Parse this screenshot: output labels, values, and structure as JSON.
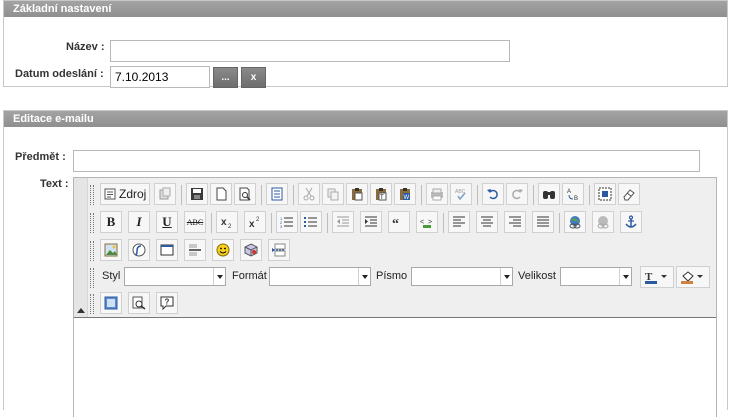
{
  "sections": {
    "basic": {
      "title": "Základní nastavení",
      "name_label": "Název :",
      "name_value": "",
      "date_label": "Datum odeslání :",
      "date_value": "7.10.2013",
      "picker_label": "...",
      "clear_label": "x"
    },
    "email": {
      "title": "Editace e-mailu",
      "subject_label": "Předmět :",
      "subject_value": "",
      "text_label": "Text :"
    }
  },
  "editor": {
    "source_label": "Zdroj",
    "style_label": "Styl",
    "format_label": "Formát",
    "font_label": "Písmo",
    "size_label": "Velikost",
    "style_value": "",
    "format_value": "",
    "font_value": "",
    "size_value": "",
    "bold_label": "B",
    "italic_label": "I",
    "underline_label": "U",
    "strike_label": "ABC",
    "icons": [
      "source-icon",
      "preview-icon",
      "save-icon",
      "new-page-icon",
      "print-preview-icon",
      "templates-icon",
      "cut-icon",
      "copy-icon",
      "paste-icon",
      "paste-text-icon",
      "paste-word-icon",
      "print-icon",
      "spellcheck-icon",
      "undo-icon",
      "redo-icon",
      "find-icon",
      "replace-icon",
      "select-all-icon",
      "remove-format-icon",
      "subscript-icon",
      "superscript-icon",
      "numbered-list-icon",
      "bulleted-list-icon",
      "outdent-icon",
      "indent-icon",
      "blockquote-icon",
      "div-icon",
      "align-left-icon",
      "align-center-icon",
      "align-right-icon",
      "justify-icon",
      "link-icon",
      "unlink-icon",
      "anchor-icon",
      "image-icon",
      "flash-icon",
      "table-icon",
      "horizontal-rule-icon",
      "smiley-icon",
      "special-char-icon",
      "page-break-icon",
      "text-color-icon",
      "background-color-icon",
      "maximize-icon",
      "show-blocks-icon",
      "about-icon"
    ]
  }
}
